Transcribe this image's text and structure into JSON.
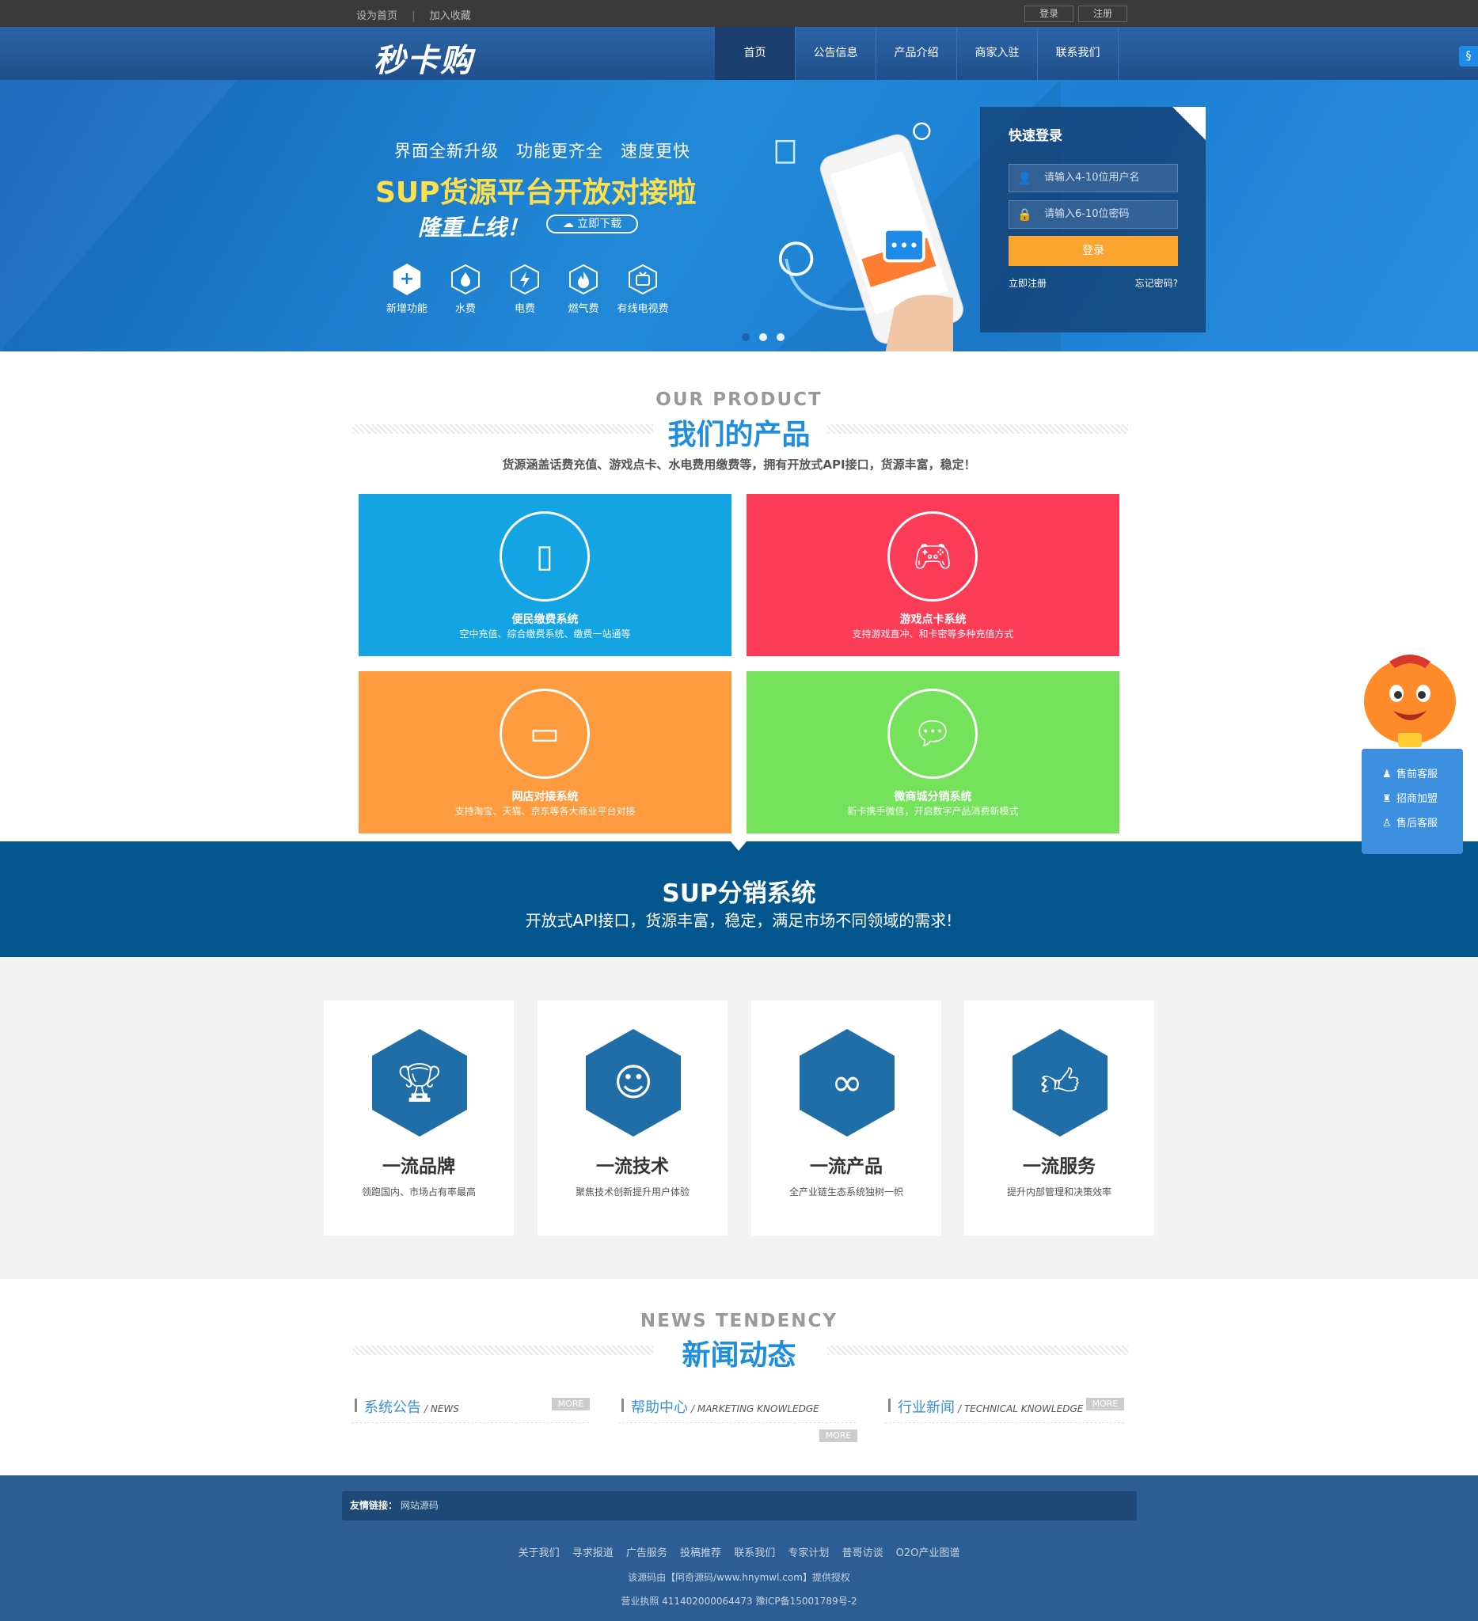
{
  "topbar": {
    "set_home": "设为首页",
    "separator": "|",
    "add_fav": "加入收藏",
    "login": "登录",
    "register": "注册"
  },
  "nav": {
    "logo": "秒卡购",
    "items": [
      "首页",
      "公告信息",
      "产品介绍",
      "商家入驻",
      "联系我们"
    ]
  },
  "banner": {
    "tagline": "界面全新升级　功能更齐全　速度更快",
    "title": "SUP货源平台开放对接啦",
    "subtitle": "隆重上线！",
    "download": "立即下载",
    "features": [
      "新增功能",
      "水费",
      "电费",
      "燃气费",
      "有线电视费"
    ],
    "slide_count": 3,
    "active_slide": 1
  },
  "login": {
    "title": "快速登录",
    "username_placeholder": "请输入4-10位用户名",
    "password_placeholder": "请输入6-10位密码",
    "submit": "登录",
    "register": "立即注册",
    "forgot": "忘记密码?"
  },
  "products": {
    "heading_en": "OUR PRODUCT",
    "heading_cn": "我们的产品",
    "description": "货源涵盖话费充值、游戏点卡、水电费用缴费等，拥有开放式API接口，货源丰富，稳定！",
    "items": [
      {
        "title": "便民缴费系统",
        "desc": "空中充值、综合缴费系统、缴费一站通等",
        "color": "#14a3e3",
        "icon": "mobile-icon"
      },
      {
        "title": "游戏点卡系统",
        "desc": "支持游戏直冲、和卡密等多种充值方式",
        "color": "#fc3c56",
        "icon": "gamepad-icon"
      },
      {
        "title": "网店对接系统",
        "desc": "支持淘宝、天猫、京东等各大商业平台对接",
        "color": "#fe9b3f",
        "icon": "monitor-icon"
      },
      {
        "title": "微商城分销系统",
        "desc": "新卡携手微信，开启数字产品消费新模式",
        "color": "#74e35b",
        "icon": "wechat-icon"
      }
    ]
  },
  "sup": {
    "title": "SUP分销系统",
    "subtitle": "开放式API接口，货源丰富，稳定，满足市场不同领域的需求!"
  },
  "advantages": [
    {
      "title": "一流品牌",
      "desc": "领跑国内、市场占有率最高",
      "icon": "trophy-icon"
    },
    {
      "title": "一流技术",
      "desc": "聚焦技术创新提升用户体验",
      "icon": "user-icon"
    },
    {
      "title": "一流产品",
      "desc": "全产业链生态系统独树一帜",
      "icon": "link-icon"
    },
    {
      "title": "一流服务",
      "desc": "提升内部管理和决策效率",
      "icon": "thumbs-up-icon"
    }
  ],
  "news": {
    "heading_en": "NEWS TENDENCY",
    "heading_cn": "新闻动态",
    "columns": [
      {
        "title": "系统公告",
        "en": "/ NEWS"
      },
      {
        "title": "帮助中心",
        "en": "/ MARKETING KNOWLEDGE"
      },
      {
        "title": "行业新闻",
        "en": "/ TECHNICAL KNOWLEDGE"
      }
    ],
    "more": "MORE"
  },
  "footer": {
    "links_label": "友情链接：",
    "links": [
      "网站源码"
    ],
    "nav": [
      "关于我们",
      "寻求报道",
      "广告服务",
      "投稿推荐",
      "联系我们",
      "专家计划",
      "普哥访谈",
      "O2O产业图谱"
    ],
    "credit": "该源码由【阿奇源码/www.hnymwl.com】提供授权",
    "license": "营业执照 411402000064473 豫ICP备15001789号-2"
  },
  "side_service": [
    "售前客服",
    "招商加盟",
    "售后客服"
  ],
  "colors": {
    "nav": "#2d64a6",
    "accent_blue": "#1d8ede",
    "sup_band": "#04568f",
    "login_button": "#f9a530",
    "footer": "#2d5e93"
  }
}
